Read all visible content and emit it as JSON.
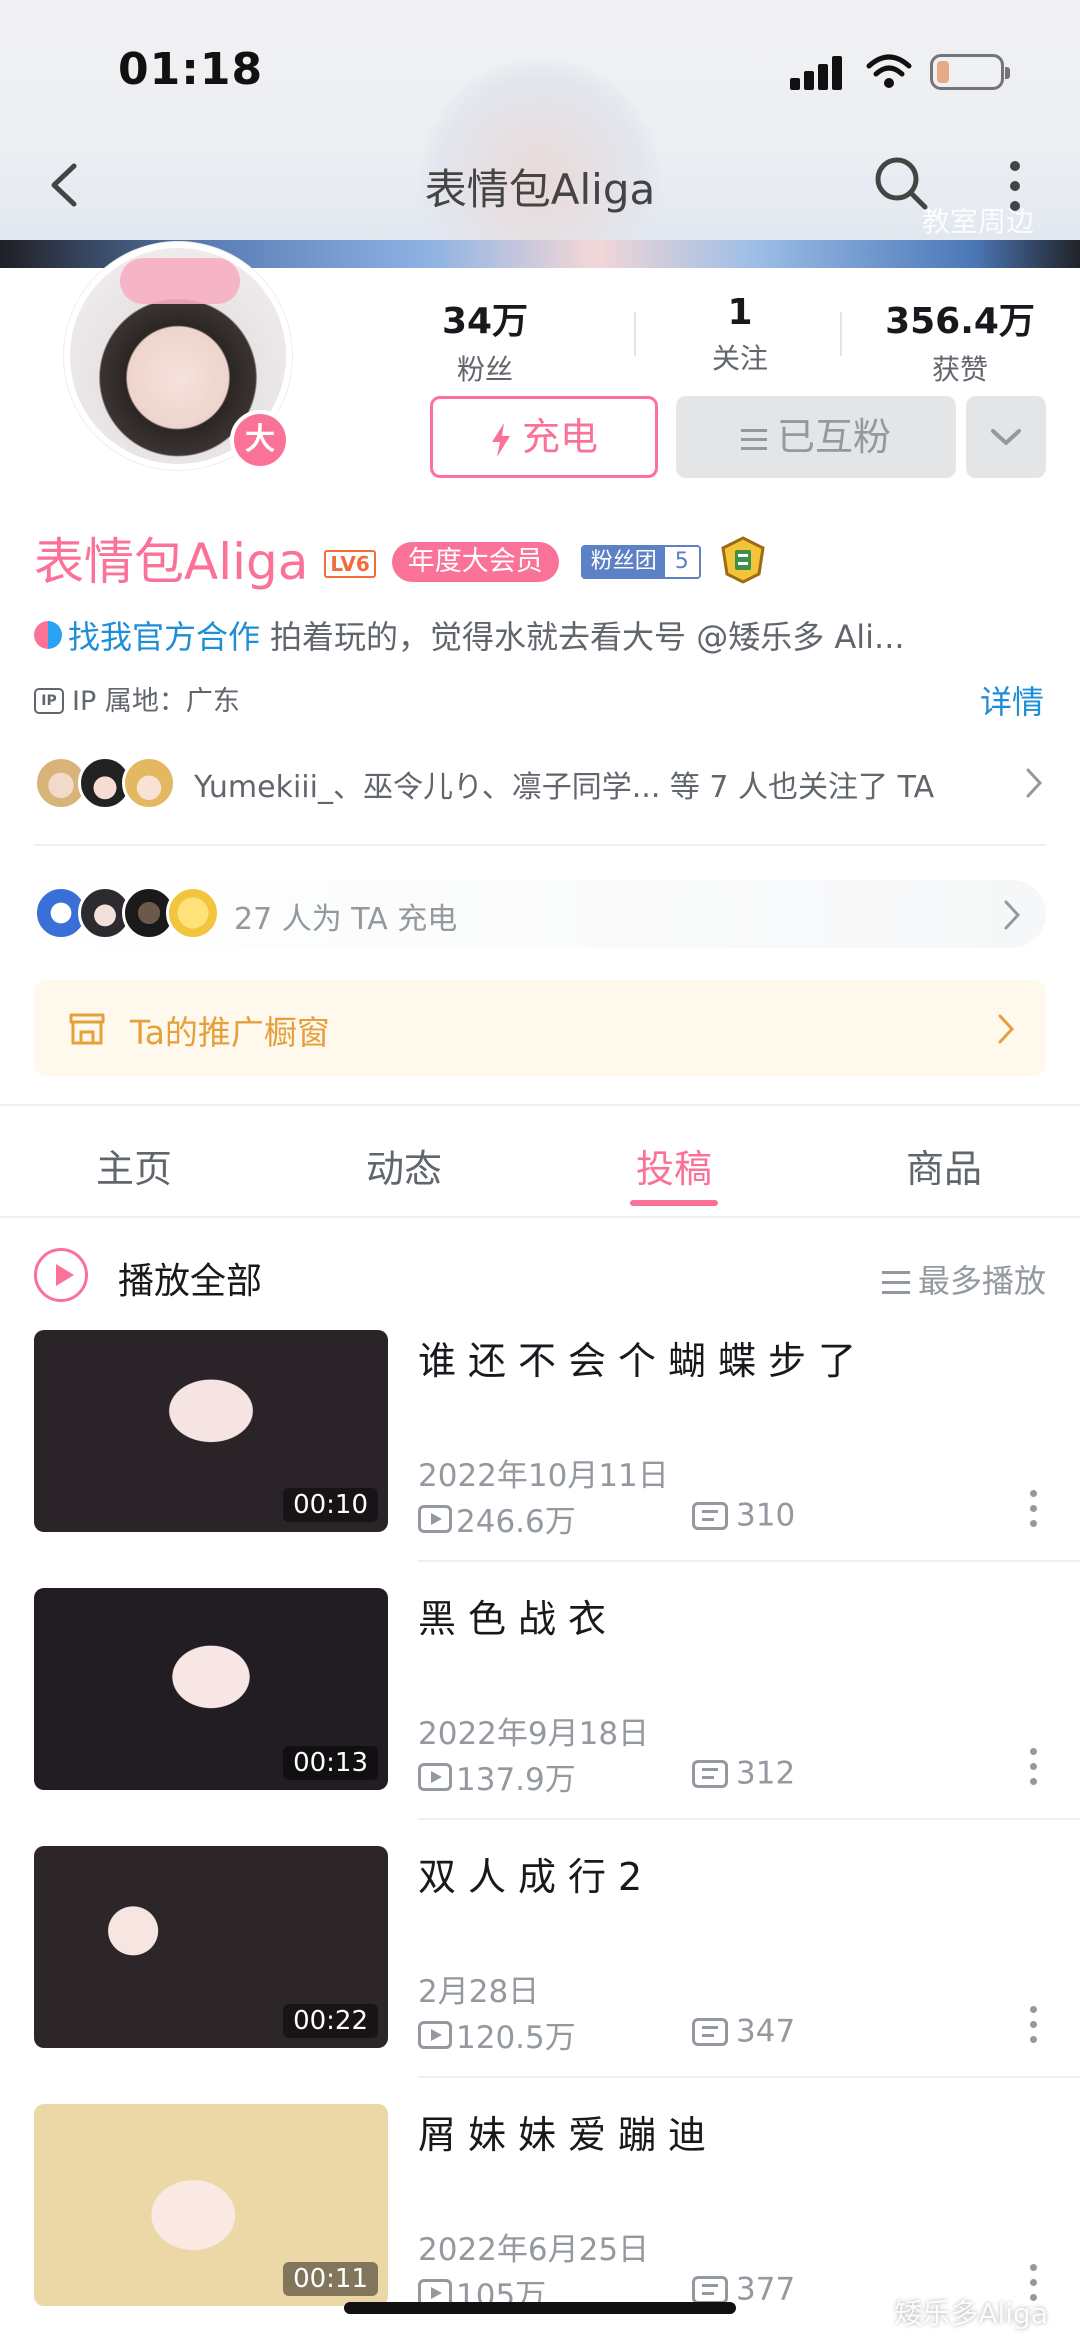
{
  "status_bar": {
    "time": "01:18"
  },
  "nav": {
    "title": "表情包Aliga",
    "banner_text": "教室周边"
  },
  "profile": {
    "vip_badge": "大",
    "stats": [
      {
        "value": "34万",
        "label": "粉丝"
      },
      {
        "value": "1",
        "label": "关注"
      },
      {
        "value": "356.4万",
        "label": "获赞"
      }
    ],
    "charge_button": "充电",
    "mutual_button": "已互粉",
    "username": "表情包Aliga",
    "level": "LV6",
    "annual_member": "年度大会员",
    "fan_club": {
      "label": "粉丝团",
      "level": "5"
    },
    "official_link": "找我官方合作",
    "bio": "拍着玩的，觉得水就去看大号 @矮乐多 Ali...",
    "ip_icon": "IP",
    "ip_location": "IP 属地：广东",
    "detail_link": "详情",
    "mutual_follow_text": "Yumekiii_、巫令儿り、凛子同学... 等 7 人也关注了 TA",
    "charge_count_text": "27 人为 TA 充电",
    "shop_window": "Ta的推广橱窗"
  },
  "tabs": [
    {
      "label": "主页",
      "active": false
    },
    {
      "label": "动态",
      "active": false
    },
    {
      "label": "投稿",
      "active": true
    },
    {
      "label": "商品",
      "active": false
    }
  ],
  "list_header": {
    "play_all": "播放全部",
    "sort": "最多播放"
  },
  "videos": [
    {
      "title": "谁还不会个蝴蝶步了",
      "date": "2022年10月11日",
      "views": "246.6万",
      "danmaku": "310",
      "duration": "00:10"
    },
    {
      "title": "黑色战衣",
      "date": "2022年9月18日",
      "views": "137.9万",
      "danmaku": "312",
      "duration": "00:13"
    },
    {
      "title": "双人成行2",
      "date": "2月28日",
      "views": "120.5万",
      "danmaku": "347",
      "duration": "00:22"
    },
    {
      "title": "屑妹妹爱蹦迪",
      "date": "2022年6月25日",
      "views": "105万",
      "danmaku": "377",
      "duration": "00:11"
    }
  ],
  "watermark": "矮乐多Aliga",
  "colors": {
    "accent": "#fb7299",
    "link": "#1e8ed8",
    "shop": "#e4a13b",
    "fan_club": "#5c81c4"
  }
}
